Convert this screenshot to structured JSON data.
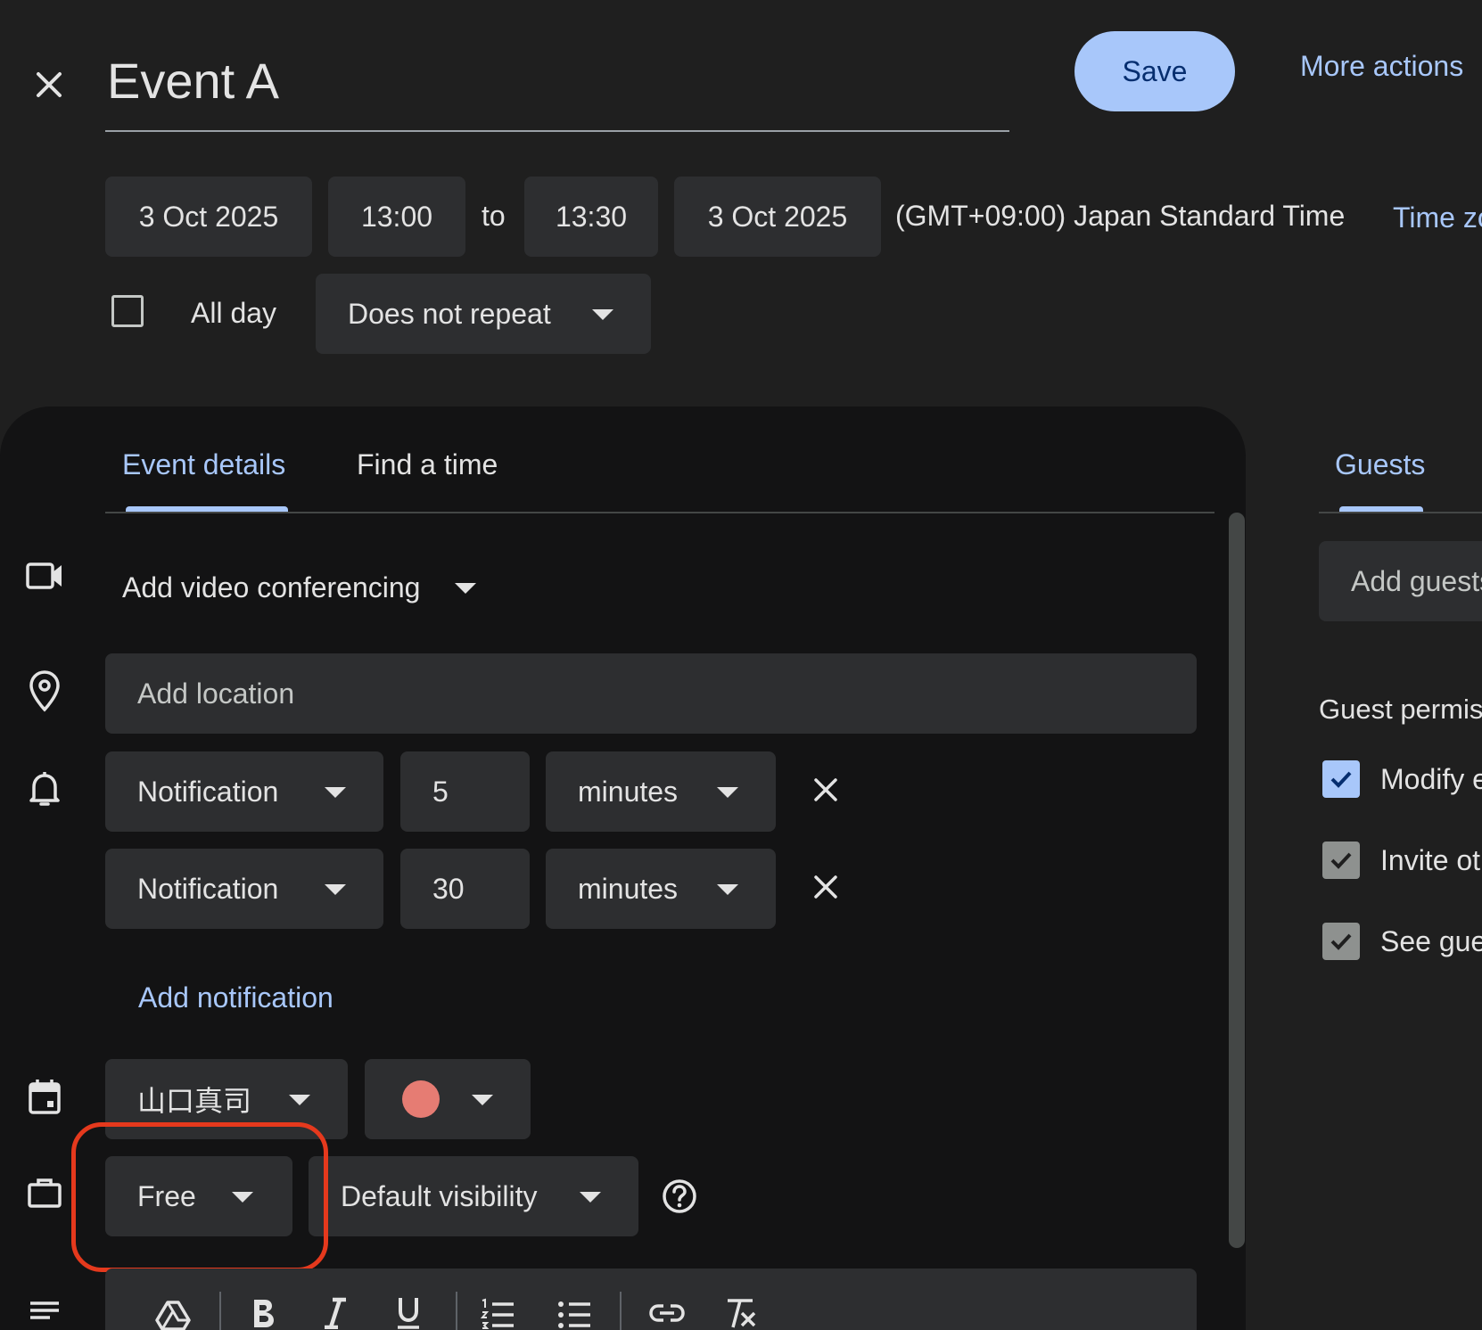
{
  "header": {
    "title": "Event A",
    "save_label": "Save",
    "more_actions_label": "More actions"
  },
  "datetime": {
    "start_date": "3 Oct 2025",
    "start_time": "13:00",
    "to_label": "to",
    "end_time": "13:30",
    "end_date": "3 Oct 2025",
    "timezone": "(GMT+09:00) Japan Standard Time",
    "timezone_link": "Time zone",
    "all_day_label": "All day",
    "repeat_label": "Does not repeat"
  },
  "tabs": {
    "event_details": "Event details",
    "find_a_time": "Find a time",
    "guests": "Guests"
  },
  "details": {
    "video_conf_label": "Add video conferencing",
    "location_placeholder": "Add location",
    "notifications": [
      {
        "type": "Notification",
        "value": "5",
        "unit": "minutes"
      },
      {
        "type": "Notification",
        "value": "30",
        "unit": "minutes"
      }
    ],
    "add_notification_label": "Add notification",
    "calendar_owner": "山口真司",
    "event_color": "#e67c73",
    "availability": "Free",
    "visibility": "Default visibility"
  },
  "guests": {
    "add_guests_placeholder": "Add guests",
    "permissions_heading": "Guest permissions",
    "permissions": [
      {
        "label": "Modify event",
        "checked": true
      },
      {
        "label": "Invite others",
        "checked": true
      },
      {
        "label": "See guest list",
        "checked": true
      }
    ]
  },
  "colors": {
    "accent": "#a8c7fa",
    "highlight_ring": "#e5391d",
    "background": "#1f1f1f",
    "panel": "#131314",
    "chip": "#2d2e30"
  }
}
